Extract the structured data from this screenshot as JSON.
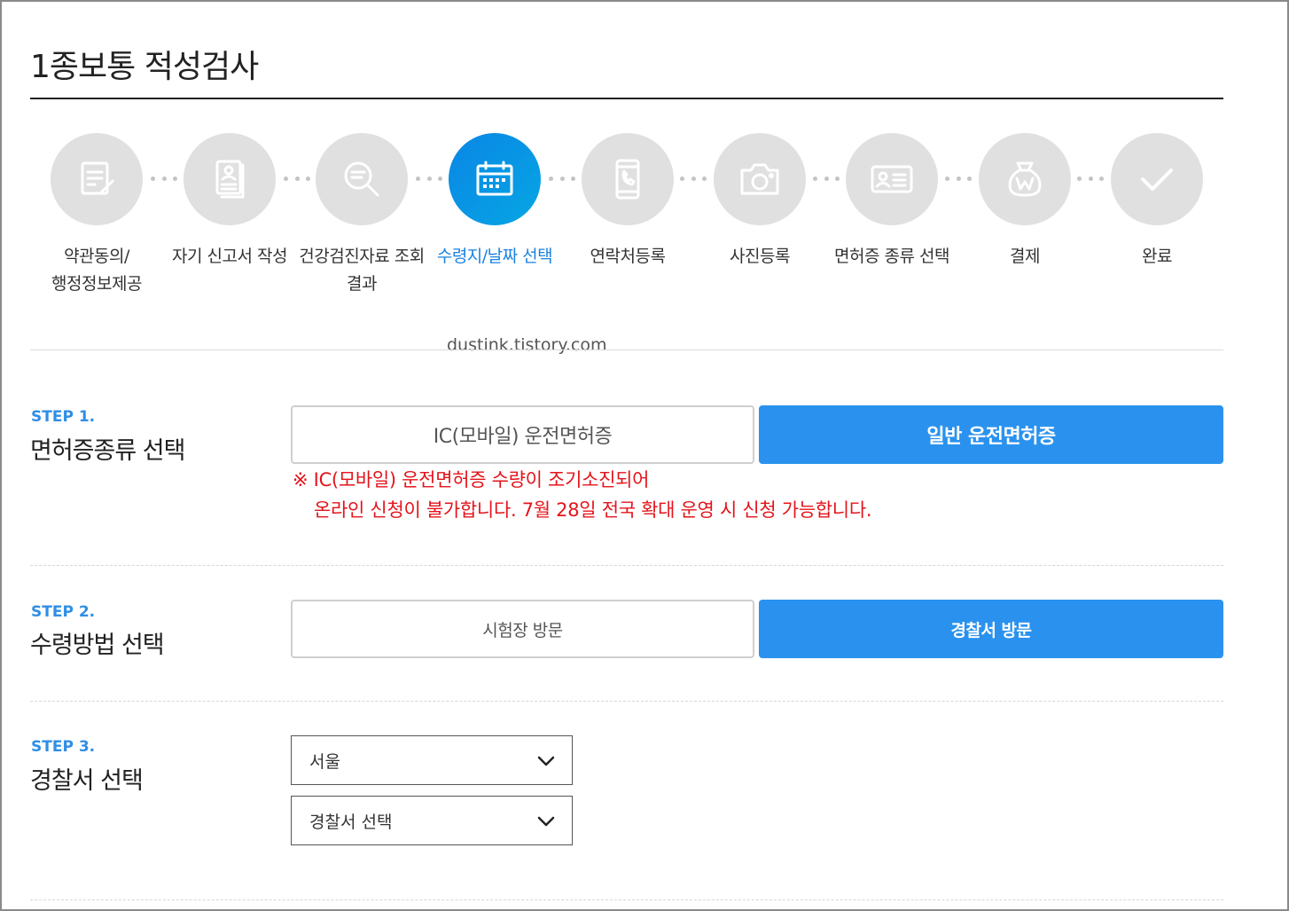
{
  "page": {
    "title": "1종보통 적성검사",
    "watermark": "dustink.tistory.com"
  },
  "progress": {
    "active_index": 3,
    "steps": [
      {
        "label": "약관동의/\n행정정보제공",
        "icon": "document-sign-icon"
      },
      {
        "label": "자기 신고서 작성",
        "icon": "profile-document-icon"
      },
      {
        "label": "건강검진자료 조회\n결과",
        "icon": "magnifier-icon"
      },
      {
        "label": "수령지/날짜 선택",
        "icon": "calendar-icon"
      },
      {
        "label": "연락처등록",
        "icon": "phone-icon"
      },
      {
        "label": "사진등록",
        "icon": "camera-icon"
      },
      {
        "label": "면허증 종류 선택",
        "icon": "id-card-icon"
      },
      {
        "label": "결제",
        "icon": "money-bag-icon"
      },
      {
        "label": "완료",
        "icon": "check-icon"
      }
    ]
  },
  "step1": {
    "tag": "STEP 1.",
    "heading": "면허증종류 선택",
    "option_ic": "IC(모바일) 운전면허증",
    "option_general": "일반 운전면허증",
    "notice_line1": "※ IC(모바일) 운전면허증 수량이 조기소진되어",
    "notice_line2": "온라인 신청이 불가합니다. 7월 28일 전국 확대 운영 시 신청 가능합니다."
  },
  "step2": {
    "tag": "STEP 2.",
    "heading": "수령방법 선택",
    "option_exam": "시험장 방문",
    "option_police": "경찰서 방문"
  },
  "step3": {
    "tag": "STEP 3.",
    "heading": "경찰서 선택",
    "region_value": "서울",
    "station_value": "경찰서 선택"
  },
  "colors": {
    "accent": "#2a92ee",
    "step_tag": "#2f8ee6",
    "notice": "#e3141b",
    "inactive_circle": "#e0e0e0"
  }
}
